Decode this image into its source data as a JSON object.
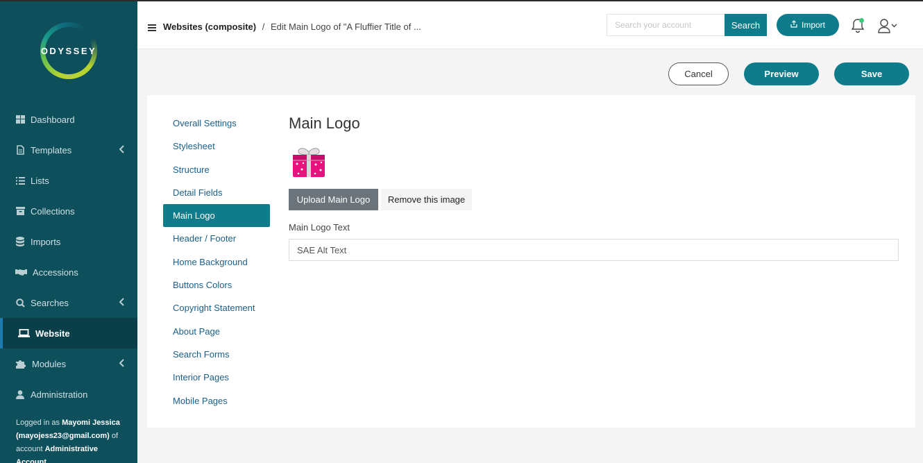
{
  "app": {
    "logo_text": "ODYSSEY"
  },
  "sidebar": {
    "items": [
      {
        "label": "Dashboard",
        "icon": "dashboard-icon"
      },
      {
        "label": "Templates",
        "icon": "file-icon"
      },
      {
        "label": "Lists",
        "icon": "list-icon"
      },
      {
        "label": "Collections",
        "icon": "archive-icon"
      },
      {
        "label": "Imports",
        "icon": "database-icon"
      },
      {
        "label": "Accessions",
        "icon": "handshake-icon"
      },
      {
        "label": "Searches",
        "icon": "search-icon"
      },
      {
        "label": "Website",
        "icon": "laptop-icon"
      },
      {
        "label": "Modules",
        "icon": "puzzle-icon"
      },
      {
        "label": "Administration",
        "icon": "user-icon"
      }
    ],
    "logged_prefix": "Logged in as",
    "user_name": "Mayomi Jessica",
    "user_email": "(mayojess23@gmail.com)",
    "of_account": "of account",
    "account_name": "Administrative Account"
  },
  "header": {
    "breadcrumb_root": "Websites (composite)",
    "breadcrumb_sep": "/",
    "breadcrumb_current": "Edit Main Logo of \"A Fluffier Title of ...",
    "search_placeholder": "Search your account",
    "search_label": "Search",
    "import_label": "Import"
  },
  "actions": {
    "cancel": "Cancel",
    "preview": "Preview",
    "save": "Save"
  },
  "settings_nav": [
    "Overall Settings",
    "Stylesheet",
    "Structure",
    "Detail Fields",
    "Main Logo",
    "Header / Footer",
    "Home Background",
    "Buttons Colors",
    "Copyright Statement",
    "About Page",
    "Search Forms",
    "Interior Pages",
    "Mobile Pages"
  ],
  "main": {
    "title": "Main Logo",
    "upload_label": "Upload Main Logo",
    "remove_label": "Remove this image",
    "logo_text_label": "Main Logo Text",
    "logo_text_value": "SAE Alt Text"
  },
  "colors": {
    "sidebar": "#0e4f5c",
    "accent": "#0f7c8c",
    "link": "#1a5e8a"
  }
}
